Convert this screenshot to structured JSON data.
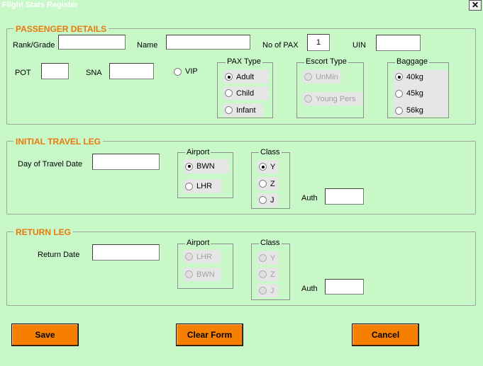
{
  "window": {
    "title": "Flight Stats Register",
    "close": "✕"
  },
  "passenger": {
    "heading": "PASSENGER DETAILS",
    "rank_label": "Rank/Grade",
    "rank_value": "",
    "name_label": "Name",
    "name_value": "",
    "pax_count_label": "No of PAX",
    "pax_count_value": "1",
    "uin_label": "UIN",
    "uin_value": "",
    "pot_label": "POT",
    "pot_value": "",
    "sna_label": "SNA",
    "sna_value": "",
    "vip_label": "VIP",
    "pax_type": {
      "title": "PAX Type",
      "options": [
        "Adult",
        "Child",
        "Infant"
      ],
      "selected": "Adult"
    },
    "escort_type": {
      "title": "Escort Type",
      "options": [
        "UnMin",
        "Young Pers"
      ]
    },
    "baggage": {
      "title": "Baggage",
      "options": [
        "40kg",
        "45kg",
        "56kg"
      ],
      "selected": "40kg"
    }
  },
  "initial_leg": {
    "heading": "INITIAL TRAVEL LEG",
    "date_label": "Day of Travel Date",
    "date_value": "",
    "airport": {
      "title": "Airport",
      "options": [
        "BWN",
        "LHR"
      ],
      "selected": "BWN"
    },
    "class": {
      "title": "Class",
      "options": [
        "Y",
        "Z",
        "J"
      ],
      "selected": "Y"
    },
    "auth_label": "Auth",
    "auth_value": ""
  },
  "return_leg": {
    "heading": "RETURN LEG",
    "date_label": "Return Date",
    "date_value": "",
    "airport": {
      "title": "Airport",
      "options": [
        "LHR",
        "BWN"
      ]
    },
    "class": {
      "title": "Class",
      "options": [
        "Y",
        "Z",
        "J"
      ]
    },
    "auth_label": "Auth",
    "auth_value": ""
  },
  "buttons": {
    "save": "Save",
    "clear": "Clear Form",
    "cancel": "Cancel"
  }
}
